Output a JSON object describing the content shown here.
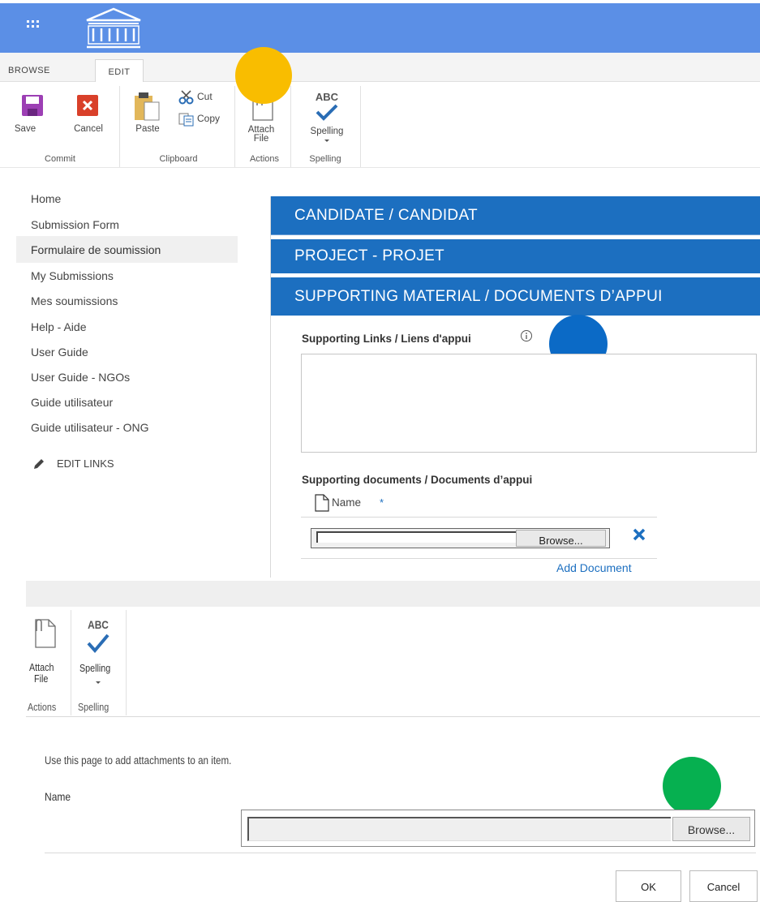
{
  "ribbon": {
    "tabs": [
      {
        "label": "BROWSE"
      },
      {
        "label": "EDIT"
      }
    ],
    "buttons": {
      "save": "Save",
      "cancel": "Cancel",
      "paste": "Paste",
      "cut": "Cut",
      "copy": "Copy",
      "attach_line1": "Attach",
      "attach_line2": "File",
      "spelling": "Spelling",
      "abc": "ABC"
    },
    "groups": {
      "commit": "Commit",
      "clipboard": "Clipboard",
      "actions": "Actions",
      "spelling": "Spelling"
    }
  },
  "nav": {
    "items": [
      {
        "label": "Home"
      },
      {
        "label": "Submission Form"
      },
      {
        "label": "Formulaire de soumission"
      },
      {
        "label": "My Submissions"
      },
      {
        "label": "Mes soumissions"
      },
      {
        "label": "Help - Aide"
      },
      {
        "label": "User Guide"
      },
      {
        "label": "User Guide - NGOs"
      },
      {
        "label": "Guide utilisateur"
      },
      {
        "label": "Guide utilisateur - ONG"
      }
    ],
    "edit_links": "EDIT LINKS"
  },
  "sections": {
    "candidate": "CANDIDATE / CANDIDAT",
    "project": "PROJECT - PROJET",
    "supporting": "SUPPORTING MATERIAL / DOCUMENTS D’APPUI"
  },
  "form": {
    "links_label": "Supporting Links / Liens d'appui",
    "docs_label": "Supporting documents / Documents d’appui",
    "name_col": "Name",
    "required_mark": "*",
    "browse": "Browse...",
    "add_document": "Add Document"
  },
  "attach_page": {
    "ribbon": {
      "attach_line1": "Attach",
      "attach_line2": "File",
      "abc": "ABC",
      "spelling": "Spelling",
      "group_actions": "Actions",
      "group_spelling": "Spelling"
    },
    "instruction": "Use this page to add attachments to an item.",
    "name_label": "Name",
    "browse": "Browse...",
    "ok": "OK",
    "cancel": "Cancel"
  },
  "markers": {
    "yellow": "#f9bd00",
    "blue": "#0b6ac6",
    "green": "#06b050"
  },
  "colors": {
    "suite_bar": "#5b8fe6",
    "section_header": "#1c6fc0",
    "link": "#1c6fc0"
  }
}
